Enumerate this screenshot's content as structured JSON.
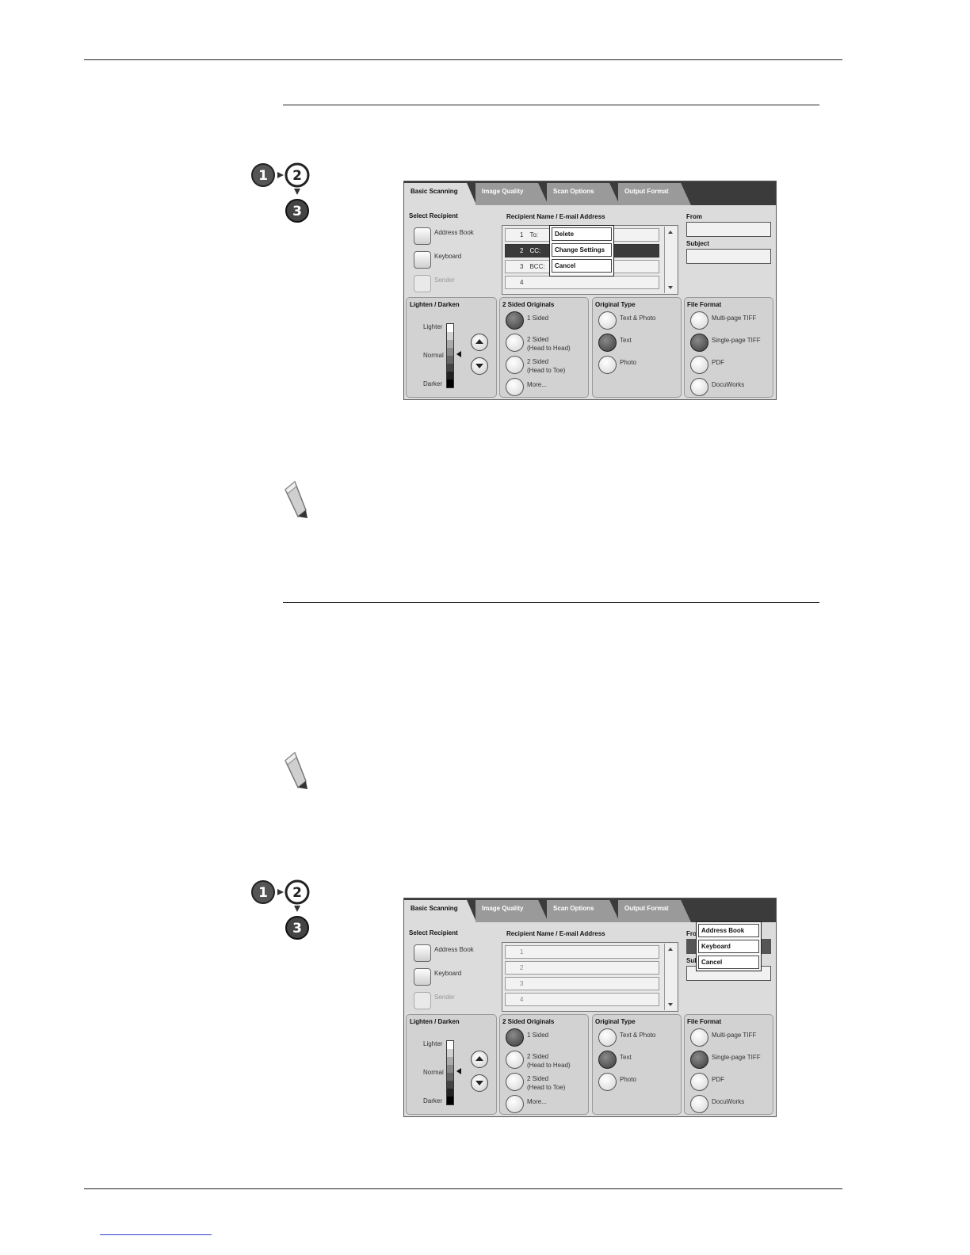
{
  "screen1": {
    "tabs": [
      "Basic Scanning",
      "Image Quality",
      "Scan Options",
      "Output Format"
    ],
    "select_recipient": {
      "label": "Select Recipient",
      "buttons": [
        "Address Book",
        "Keyboard",
        "Sender"
      ]
    },
    "recipient_header": "Recipient Name / E-mail Address",
    "recipients": [
      {
        "num": "1",
        "type": "To:"
      },
      {
        "num": "2",
        "type": "CC:"
      },
      {
        "num": "3",
        "type": "BCC:"
      },
      {
        "num": "4",
        "type": ""
      }
    ],
    "context_menu": [
      "Delete",
      "Change Settings",
      "Cancel"
    ],
    "from_label": "From",
    "subject_label": "Subject",
    "lighten_darken": {
      "label": "Lighten / Darken",
      "lighter": "Lighter",
      "normal": "Normal",
      "darker": "Darker"
    },
    "two_sided": {
      "label": "2 Sided Originals",
      "options": [
        "1 Sided",
        "2 Sided\n(Head to Head)",
        "2 Sided\n(Head to Toe)",
        "More..."
      ]
    },
    "original_type": {
      "label": "Original Type",
      "options": [
        "Text & Photo",
        "Text",
        "Photo"
      ]
    },
    "file_format": {
      "label": "File Format",
      "options": [
        "Multi-page TIFF",
        "Single-page TIFF",
        "PDF",
        "DocuWorks"
      ]
    }
  },
  "screen2": {
    "tabs": [
      "Basic Scanning",
      "Image Quality",
      "Scan Options",
      "Output Format"
    ],
    "select_recipient": {
      "label": "Select Recipient",
      "buttons": [
        "Address Book",
        "Keyboard",
        "Sender"
      ]
    },
    "recipient_header": "Recipient Name / E-mail Address",
    "recipients": [
      {
        "num": "1",
        "type": ""
      },
      {
        "num": "2",
        "type": ""
      },
      {
        "num": "3",
        "type": ""
      },
      {
        "num": "4",
        "type": ""
      }
    ],
    "popup_menu": [
      "Address Book",
      "Keyboard",
      "Cancel"
    ],
    "from_label": "Fro",
    "subject_label": "Sub",
    "lighten_darken": {
      "label": "Lighten / Darken",
      "lighter": "Lighter",
      "normal": "Normal",
      "darker": "Darker"
    },
    "two_sided": {
      "label": "2 Sided Originals",
      "options": [
        "1 Sided",
        "2 Sided\n(Head to Head)",
        "2 Sided\n(Head to Toe)",
        "More..."
      ]
    },
    "original_type": {
      "label": "Original Type",
      "options": [
        "Text & Photo",
        "Text",
        "Photo"
      ]
    },
    "file_format": {
      "label": "File Format",
      "options": [
        "Multi-page TIFF",
        "Single-page TIFF",
        "PDF",
        "DocuWorks"
      ]
    }
  },
  "steps_icon": {
    "digits": [
      "1",
      "2",
      "3"
    ]
  }
}
